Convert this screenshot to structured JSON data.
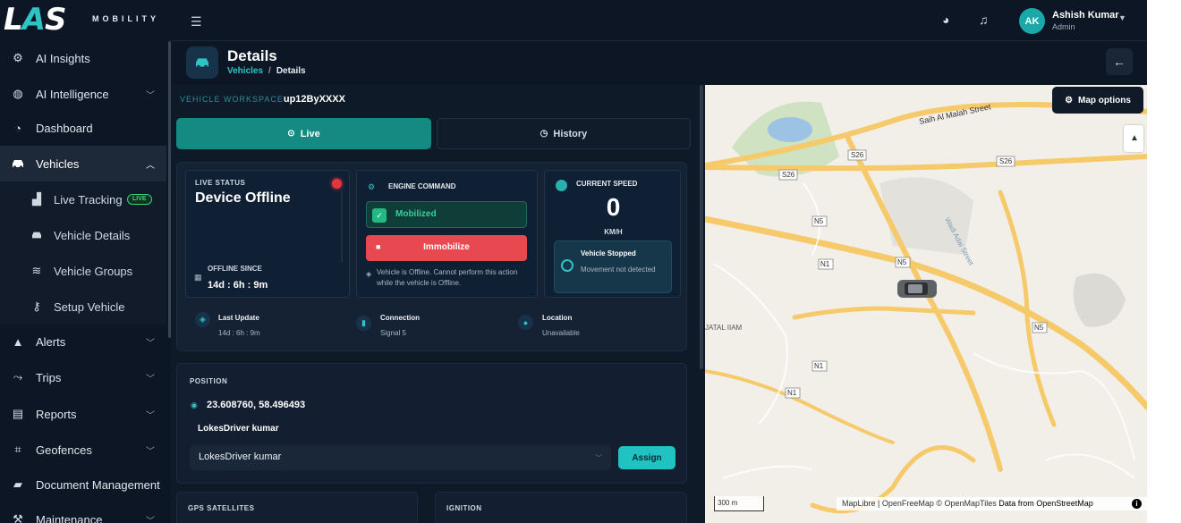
{
  "brand": {
    "logo_text": "LAS",
    "subtitle": "MOBILITY"
  },
  "sidebar": {
    "items": [
      {
        "label": "AI Insights",
        "icon": "robot-icon"
      },
      {
        "label": "AI Intelligence",
        "icon": "brain-icon"
      },
      {
        "label": "Dashboard",
        "icon": "gauge-icon"
      },
      {
        "label": "Vehicles",
        "icon": "car-icon"
      },
      {
        "label": "Alerts",
        "icon": "warning-icon"
      },
      {
        "label": "Trips",
        "icon": "route-icon"
      },
      {
        "label": "Reports",
        "icon": "report-icon"
      },
      {
        "label": "Geofences",
        "icon": "geofence-icon"
      },
      {
        "label": "Document Management",
        "icon": "folder-icon"
      },
      {
        "label": "Maintenance",
        "icon": "wrench-icon"
      }
    ],
    "vehicle_sub": [
      {
        "label": "Live Tracking",
        "badge": "LIVE"
      },
      {
        "label": "Vehicle Details"
      },
      {
        "label": "Vehicle Groups"
      },
      {
        "label": "Setup Vehicle"
      }
    ]
  },
  "topbar": {
    "user_initials": "AK",
    "user_name": "Ashish Kumar",
    "user_role": "Admin"
  },
  "header": {
    "title": "Details",
    "breadcrumb_parent": "Vehicles",
    "breadcrumb_current": "Details"
  },
  "workspace": {
    "label": "VEHICLE WORKSPACE",
    "vehicle_id": "up12ByXXXX"
  },
  "tabs": {
    "live": "Live",
    "history": "History"
  },
  "live_status": {
    "label": "LIVE STATUS",
    "status": "Device Offline",
    "offline_since_label": "OFFLINE SINCE",
    "offline_since_value": "14d : 6h : 9m",
    "indicator_color": "#e8343c"
  },
  "engine": {
    "label": "ENGINE COMMAND",
    "mobilized": "Mobilized",
    "immobilize": "Immobilize",
    "note": "Vehicle is Offline. Cannot perform this action while the vehicle is Offline."
  },
  "speed": {
    "label": "CURRENT SPEED",
    "value": "0",
    "unit": "KM/H",
    "state_title": "Vehicle Stopped",
    "state_sub": "Movement not detected"
  },
  "stats": {
    "last_update_label": "Last Update",
    "last_update_value": "14d : 6h : 9m",
    "connection_label": "Connection",
    "connection_value": "Signal 5",
    "location_label": "Location",
    "location_value": "Unavailable"
  },
  "position": {
    "label": "POSITION",
    "coords": "23.608760, 58.496493",
    "driver_name": "LokesDriver kumar",
    "select_value": "LokesDriver kumar",
    "assign": "Assign"
  },
  "bottom_cards": {
    "gps": "GPS SATELLITES",
    "ignition": "IGNITION"
  },
  "map": {
    "options_label": "Map options",
    "scale": "300 m",
    "attribution": "MapLibre | OpenFreeMap © OpenMapTiles",
    "attribution_data": "Data from OpenStreetMap",
    "street_label": "Saih Al Malah Street",
    "wadi_label": "Wadi Adai Street",
    "road_labels": [
      "S26",
      "S26",
      "S26",
      "N5",
      "N5",
      "N5",
      "N1",
      "N1",
      "N1"
    ],
    "area_label": "JATAL IIAM",
    "colors": {
      "road": "#f6c96a",
      "park": "#cfe3c2",
      "water": "#9cc2e4",
      "land": "#f2efe9"
    }
  }
}
